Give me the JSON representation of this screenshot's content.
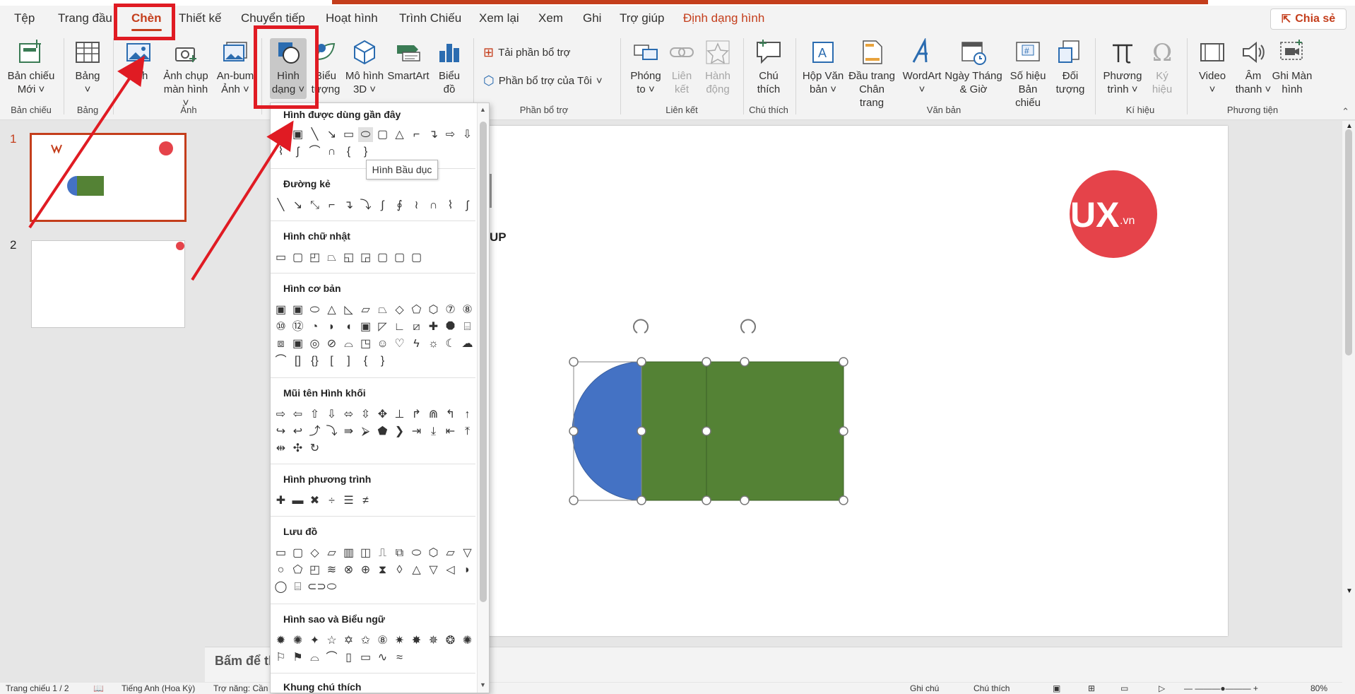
{
  "tabs": [
    "Tệp",
    "Trang đầu",
    "Chèn",
    "Thiết kế",
    "Chuyển tiếp",
    "Hoạt hình",
    "Trình Chiếu",
    "Xem lại",
    "Xem",
    "Ghi",
    "Trợ giúp",
    "Định dạng hình"
  ],
  "share_label": "Chia sẻ",
  "ribbon": {
    "new_slide": [
      "Bản chiếu",
      "Mới"
    ],
    "table": "Bảng",
    "picture": "Ảnh",
    "screenshot": [
      "Ảnh chụp",
      "màn hình"
    ],
    "album": [
      "An-bum",
      "Ảnh"
    ],
    "shapes": [
      "Hình",
      "dạng"
    ],
    "icons": [
      "Biểu",
      "tượng"
    ],
    "model3d": [
      "Mô hình",
      "3D"
    ],
    "smartart": "SmartArt",
    "chart": [
      "Biểu",
      "đồ"
    ],
    "get_addins": "Tải phần bổ trợ",
    "my_addins": "Phần bổ trợ của Tôi",
    "zoom": [
      "Phóng",
      "to"
    ],
    "link": [
      "Liên",
      "kết"
    ],
    "action": [
      "Hành",
      "động"
    ],
    "comment": [
      "Chú",
      "thích"
    ],
    "textbox": [
      "Hộp Văn",
      "bản"
    ],
    "header_footer": [
      "Đầu trang",
      "Chân trang"
    ],
    "wordart": "WordArt",
    "datetime": [
      "Ngày Tháng",
      "& Giờ"
    ],
    "slide_number": [
      "Số hiệu",
      "Bản chiếu"
    ],
    "object": [
      "Đối",
      "tượng"
    ],
    "equation": [
      "Phương",
      "trình"
    ],
    "symbol": [
      "Ký",
      "hiệu"
    ],
    "video": "Video",
    "audio": [
      "Âm",
      "thanh"
    ],
    "screen_recording": [
      "Ghi Màn",
      "hình"
    ]
  },
  "groups": {
    "slides": "Bản chiếu",
    "tables": "Bảng",
    "images": "Ảnh",
    "addins": "Phần bổ trợ",
    "links": "Liên kết",
    "comments": "Chú thích",
    "text": "Văn bản",
    "symbols": "Kí hiệu",
    "media": "Phương tiện"
  },
  "shapes_panel": {
    "sections": [
      "Hình được dùng gần đây",
      "Đường kẻ",
      "Hình chữ nhật",
      "Hình cơ bản",
      "Mũi tên Hình khối",
      "Hình phương trình",
      "Lưu đồ",
      "Hình sao và Biểu ngữ",
      "Khung chú thích"
    ],
    "tooltip": "Hình Bầu dục"
  },
  "thumbnails": {
    "numbers": [
      "1",
      "2"
    ]
  },
  "slide": {
    "logo_text": "UX",
    "logo_suffix": ".vn",
    "partial_text": "UP"
  },
  "notes_placeholder": "Bấm để thêm ghi chú",
  "status": {
    "slide": "Trang chiếu 1 / 2",
    "language": "Tiếng Anh (Hoa Kỳ)",
    "accessibility": "Trợ năng: Cần điều tra",
    "notes": "Ghi chú",
    "comments": "Chú thích",
    "zoom": "80%"
  },
  "colors": {
    "accent": "#c43e1c",
    "annotation_red": "#e01b23",
    "blue_shape": "#4472c4",
    "green_shape": "#548235",
    "logo_red": "#e5434a"
  }
}
